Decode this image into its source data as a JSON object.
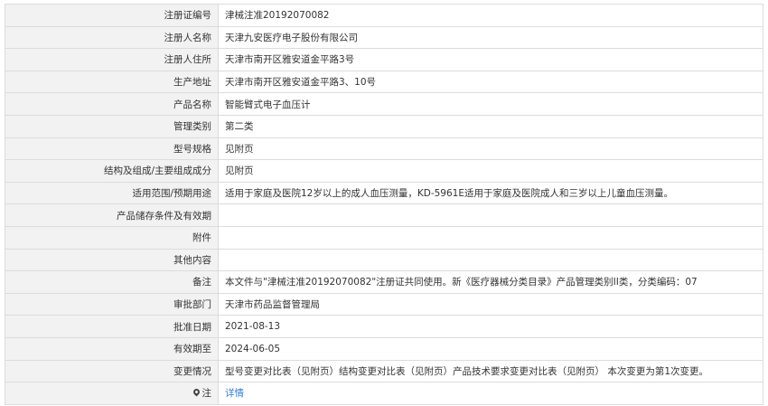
{
  "rows": [
    {
      "label": "注册证编号",
      "value": "津械注准20192070082"
    },
    {
      "label": "注册人名称",
      "value": "天津九安医疗电子股份有限公司"
    },
    {
      "label": "注册人住所",
      "value": "天津市南开区雅安道金平路3号"
    },
    {
      "label": "生产地址",
      "value": "天津市南开区雅安道金平路3、10号"
    },
    {
      "label": "产品名称",
      "value": "智能臂式电子血压计"
    },
    {
      "label": "管理类别",
      "value": "第二类"
    },
    {
      "label": "型号规格",
      "value": "见附页"
    },
    {
      "label": "结构及组成/主要组成成分",
      "value": "见附页"
    },
    {
      "label": "适用范围/预期用途",
      "value": "适用于家庭及医院12岁以上的成人血压测量，KD-5961E适用于家庭及医院成人和三岁以上儿童血压测量。"
    },
    {
      "label": "产品储存条件及有效期",
      "value": ""
    },
    {
      "label": "附件",
      "value": ""
    },
    {
      "label": "其他内容",
      "value": ""
    },
    {
      "label": "备注",
      "value": "本文件与\"津械注准20192070082\"注册证共同使用。新《医疗器械分类目录》产品管理类别II类，分类编码：07"
    },
    {
      "label": "审批部门",
      "value": "天津市药品监督管理局"
    },
    {
      "label": "批准日期",
      "value": "2021-08-13"
    },
    {
      "label": "有效期至",
      "value": "2024-06-05"
    },
    {
      "label": "变更情况",
      "value": "型号变更对比表（见附页）结构变更对比表（见附页）产品技术要求变更对比表（见附页） 本次变更为第1次变更。"
    }
  ],
  "note": {
    "label": "注",
    "icon": "pin-icon",
    "link_text": "详情",
    "link_color": "#3a7bd5"
  }
}
